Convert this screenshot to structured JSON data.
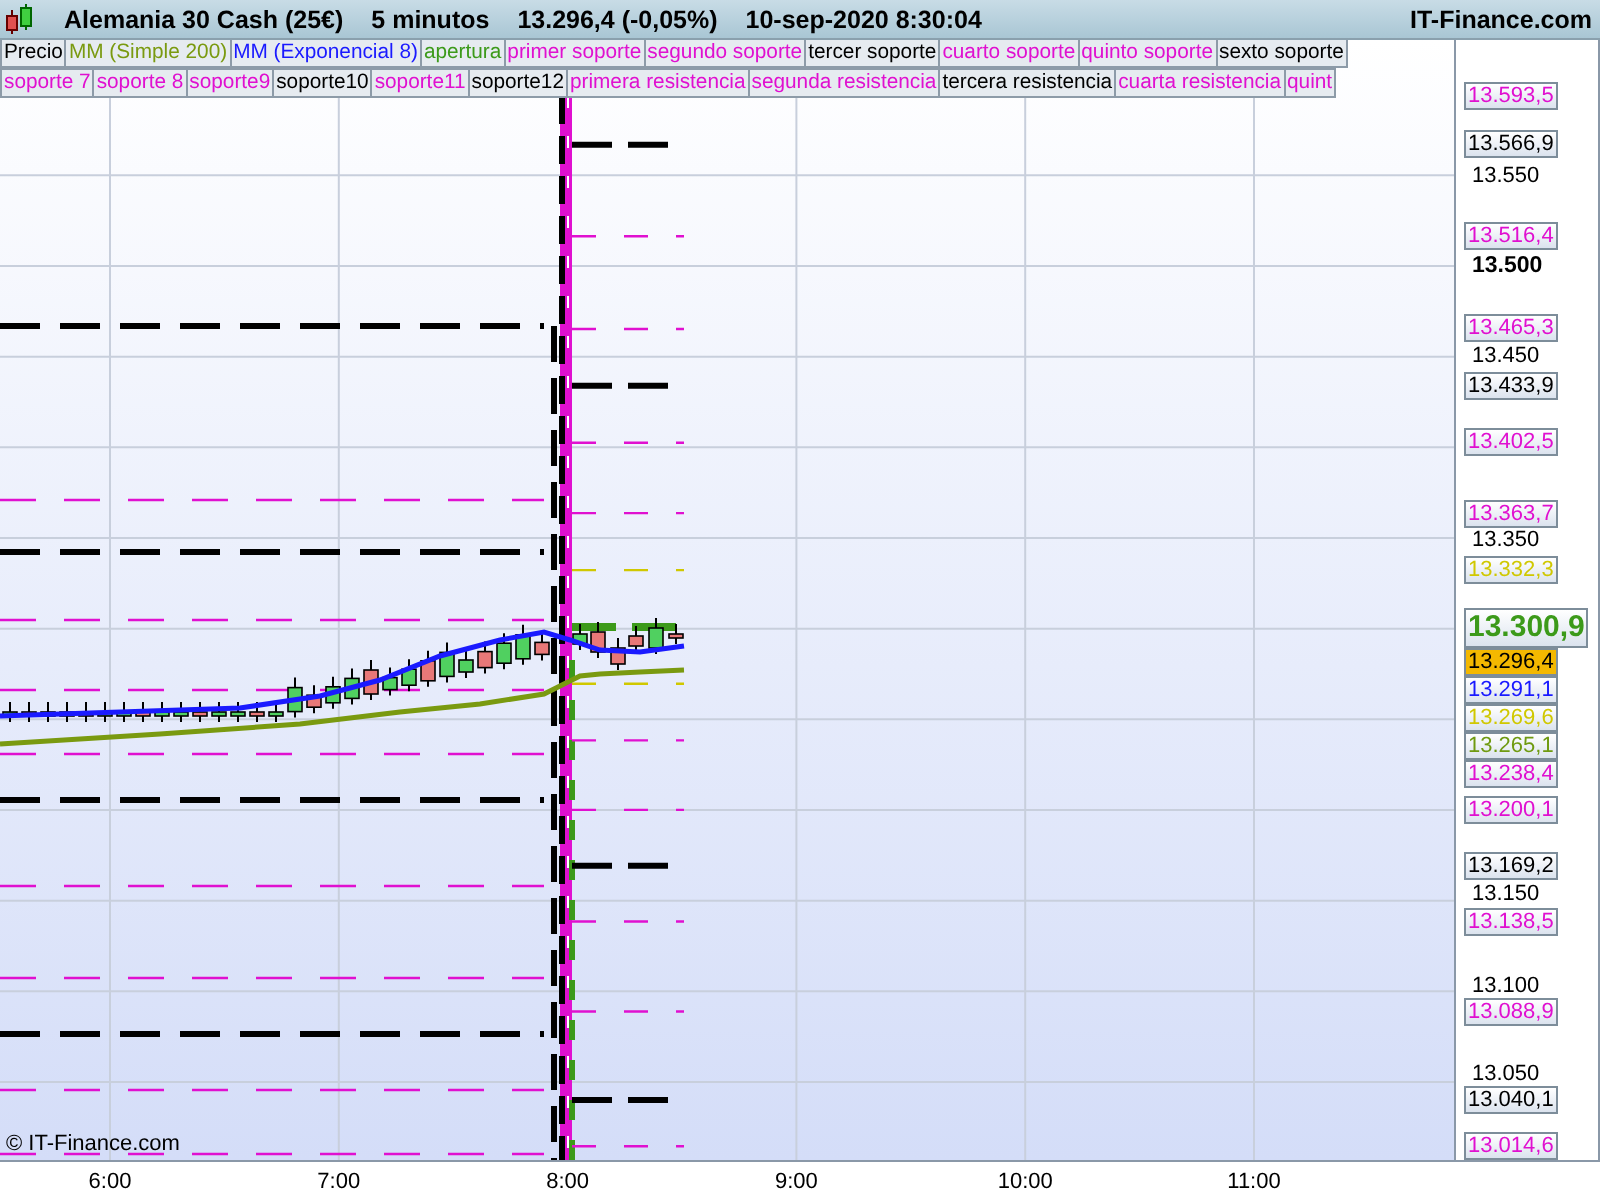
{
  "header": {
    "title": "Alemania 30 Cash (25€)",
    "interval": "5 minutos",
    "quote": "13.296,4 (-0,05%)",
    "datetime": "10-sep-2020 8:30:04",
    "site": "IT-Finance.com"
  },
  "legend_rows": [
    {
      "items": [
        {
          "label": "Precio",
          "color": "#000000"
        },
        {
          "label": "MM (Simple 200)",
          "color": "#7a9a10"
        },
        {
          "label": "MM (Exponencial 8)",
          "color": "#1a1aff"
        },
        {
          "label": "apertura",
          "color": "#3c9a1a"
        },
        {
          "label": "primer soporte",
          "color": "#e010d0"
        },
        {
          "label": "segundo soporte",
          "color": "#e010d0"
        },
        {
          "label": "tercer soporte",
          "color": "#000000"
        },
        {
          "label": "cuarto soporte",
          "color": "#e010d0"
        },
        {
          "label": "quinto soporte",
          "color": "#e010d0"
        },
        {
          "label": "sexto soporte",
          "color": "#000000"
        }
      ]
    },
    {
      "items": [
        {
          "label": "soporte 7",
          "color": "#e010d0"
        },
        {
          "label": "soporte 8",
          "color": "#e010d0"
        },
        {
          "label": "soporte9",
          "color": "#e010d0"
        },
        {
          "label": "soporte10",
          "color": "#000000"
        },
        {
          "label": "soporte11",
          "color": "#e010d0"
        },
        {
          "label": "soporte12",
          "color": "#000000"
        },
        {
          "label": "primera resistencia",
          "color": "#e010d0"
        },
        {
          "label": "segunda resistencia",
          "color": "#e010d0"
        },
        {
          "label": "tercera resistencia",
          "color": "#000000"
        },
        {
          "label": "cuarta resistencia",
          "color": "#e010d0"
        },
        {
          "label": "quint",
          "color": "#e010d0"
        }
      ]
    }
  ],
  "price_ticks": [
    {
      "label": "13.550",
      "bold": false
    },
    {
      "label": "13.500",
      "bold": true
    },
    {
      "label": "13.450",
      "bold": false
    },
    {
      "label": "13.350",
      "bold": false
    },
    {
      "label": "13.150",
      "bold": false
    },
    {
      "label": "13.100",
      "bold": false
    },
    {
      "label": "13.050",
      "bold": false
    }
  ],
  "levels": [
    {
      "label": "13.593,5",
      "kind": "minor",
      "color": "#e010d0"
    },
    {
      "label": "13.566,9",
      "kind": "major",
      "color": "#000000"
    },
    {
      "label": "13.516,4",
      "kind": "minor",
      "color": "#e010d0"
    },
    {
      "label": "13.465,3",
      "kind": "minor",
      "color": "#e010d0"
    },
    {
      "label": "13.433,9",
      "kind": "major",
      "color": "#000000"
    },
    {
      "label": "13.402,5",
      "kind": "minor",
      "color": "#e010d0"
    },
    {
      "label": "13.363,7",
      "kind": "minor",
      "color": "#e010d0"
    },
    {
      "label": "13.332,3",
      "kind": "minor",
      "color": "#d0c800"
    },
    {
      "label": "13.300,9",
      "kind": "open",
      "color": "#3c9a1a"
    },
    {
      "label": "13.296,4",
      "kind": "quote",
      "color": "#f4b800"
    },
    {
      "label": "13.291,1",
      "kind": "average",
      "color": "#1a1aff"
    },
    {
      "label": "13.269,6",
      "kind": "minor",
      "color": "#d0c800"
    },
    {
      "label": "13.265,1",
      "kind": "average",
      "color": "#6f9a10"
    },
    {
      "label": "13.238,4",
      "kind": "minor",
      "color": "#e010d0"
    },
    {
      "label": "13.200,1",
      "kind": "minor",
      "color": "#e010d0"
    },
    {
      "label": "13.169,2",
      "kind": "major",
      "color": "#000000"
    },
    {
      "label": "13.138,5",
      "kind": "minor",
      "color": "#e010d0"
    },
    {
      "label": "13.088,9",
      "kind": "minor",
      "color": "#e010d0"
    },
    {
      "label": "13.040,1",
      "kind": "major",
      "color": "#000000"
    },
    {
      "label": "13.014,6",
      "kind": "minor",
      "color": "#e010d0"
    }
  ],
  "time_ticks": [
    "6:00",
    "7:00",
    "8:00",
    "9:00",
    "10:00",
    "11:00"
  ],
  "copyright": "© IT-Finance.com"
}
